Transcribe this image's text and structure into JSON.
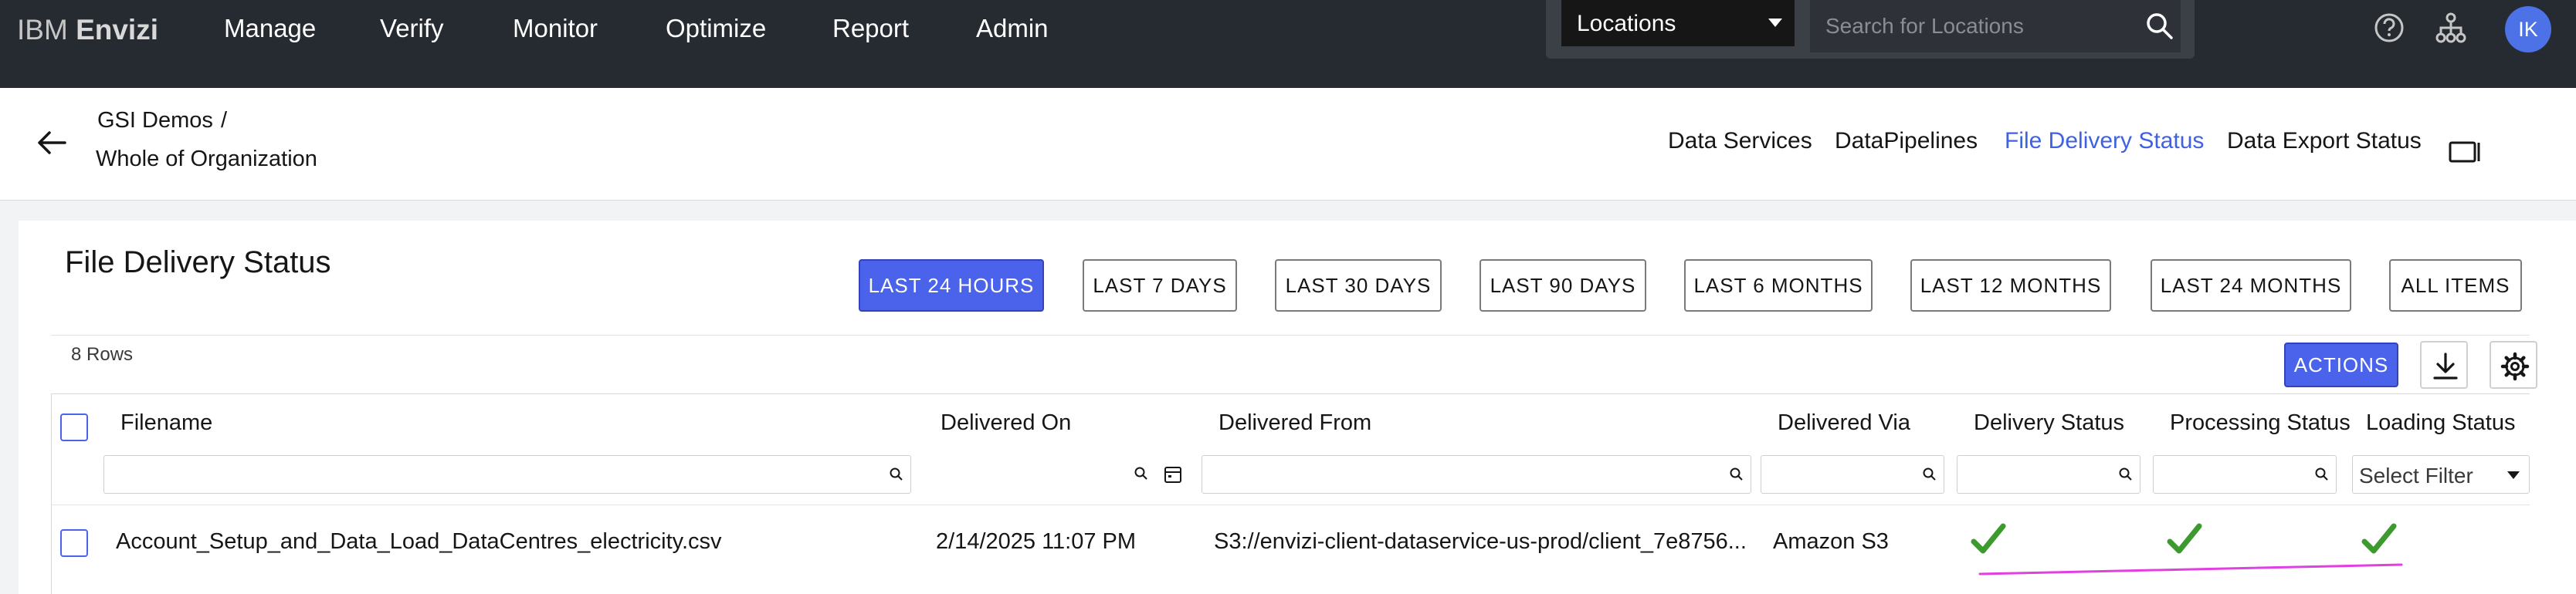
{
  "topnav": {
    "brand_light": "IBM",
    "brand_bold": "Envizi",
    "menu": [
      "Manage",
      "Verify",
      "Monitor",
      "Optimize",
      "Report",
      "Admin"
    ],
    "location_select": "Locations",
    "search_placeholder": "Search for Locations",
    "avatar_initials": "IK",
    "icons": [
      "help-icon",
      "org-hierarchy-icon"
    ]
  },
  "breadcrumb": {
    "parent": "GSI Demos",
    "separator": "/",
    "current": "Whole of Organization"
  },
  "subtabs": [
    "Data Services",
    "DataPipelines",
    "File Delivery Status",
    "Data Export Status"
  ],
  "active_subtab": "File Delivery Status",
  "page": {
    "title": "File Delivery Status",
    "periods": [
      "LAST 24 HOURS",
      "LAST 7 DAYS",
      "LAST 30 DAYS",
      "LAST 90 DAYS",
      "LAST 6 MONTHS",
      "LAST 12 MONTHS",
      "LAST 24 MONTHS",
      "ALL ITEMS"
    ],
    "active_period": "LAST 24 HOURS",
    "rows_count": "8 Rows",
    "actions_label": "ACTIONS"
  },
  "table": {
    "columns": [
      "Filename",
      "Delivered On",
      "Delivered From",
      "Delivered Via",
      "Delivery Status",
      "Processing Status",
      "Loading Status"
    ],
    "loading_filter_placeholder": "Select Filter",
    "rows": [
      {
        "filename": "Account_Setup_and_Data_Load_DataCentres_electricity.csv",
        "delivered_on": "2/14/2025 11:07 PM",
        "delivered_from": "S3://envizi-client-dataservice-us-prod/client_7e8756...",
        "delivered_via": "Amazon S3",
        "delivery_status": "success",
        "processing_status": "success",
        "loading_status": "success"
      }
    ]
  },
  "colors": {
    "topnav_bg": "#262a31",
    "accent": "#4a63ea",
    "active_tab": "#3f62e0",
    "success_check": "#3d9a2e",
    "annotation_line": "#e040e0"
  }
}
